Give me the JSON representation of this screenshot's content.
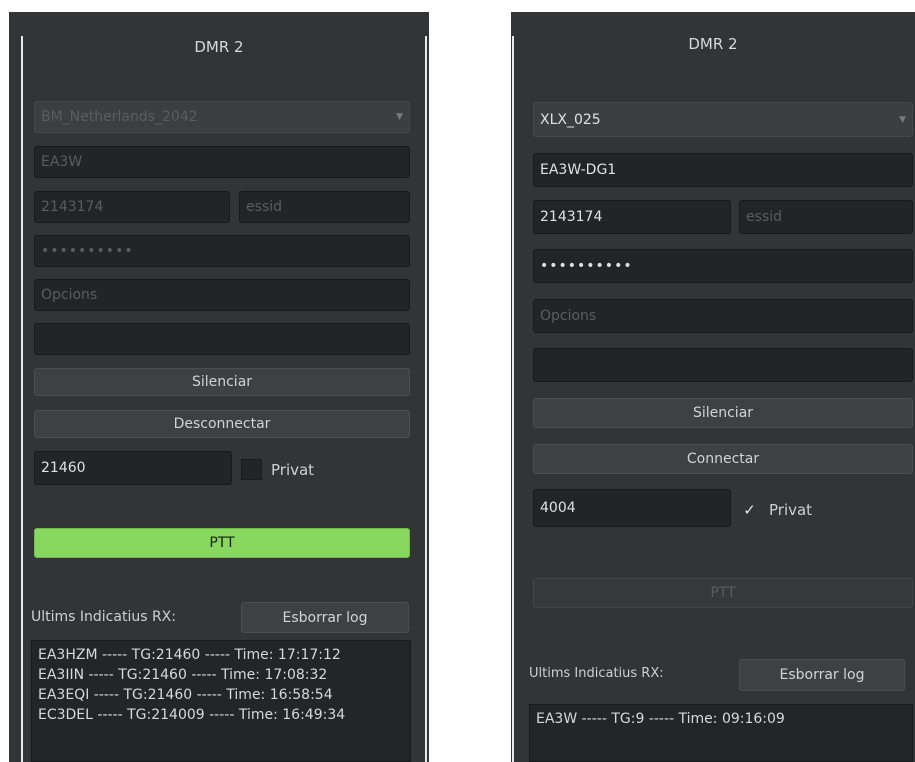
{
  "panels": [
    {
      "title": "DMR 2",
      "server": "BM_Netherlands_2042",
      "callsign": "EA3W",
      "id": "2143174",
      "essid_placeholder": "essid",
      "password": "••••••••••",
      "options_placeholder": "Opcions",
      "extra": "",
      "mute_label": "Silenciar",
      "connect_label": "Desconnectar",
      "talkgroup": "21460",
      "private_label": "Privat",
      "private_checked": false,
      "ptt_label": "PTT",
      "ptt_active": true,
      "log_label": "Ultims Indicatius RX:",
      "clear_log_label": "Esborrar log",
      "log_entries": [
        "EA3HZM ----- TG:21460 ----- Time: 17:17:12",
        "EA3IIN ----- TG:21460 ----- Time: 17:08:32",
        "EA3EQI ----- TG:21460 ----- Time: 16:58:54",
        "EC3DEL ----- TG:214009 ----- Time: 16:49:34"
      ]
    },
    {
      "title": "DMR 2",
      "server": "XLX_025",
      "callsign": "EA3W-DG1",
      "id": "2143174",
      "essid_placeholder": "essid",
      "password": "••••••••••",
      "options_placeholder": "Opcions",
      "extra": "",
      "mute_label": "Silenciar",
      "connect_label": "Connectar",
      "talkgroup": "4004",
      "private_label": "Privat",
      "private_checked": true,
      "checkmark": "✓",
      "ptt_label": "PTT",
      "ptt_active": false,
      "log_label": "Ultims Indicatius RX:",
      "clear_log_label": "Esborrar log",
      "log_entries": [
        "EA3W ----- TG:9 ----- Time: 09:16:09"
      ]
    }
  ],
  "icons": {
    "dropdown": "▼"
  }
}
